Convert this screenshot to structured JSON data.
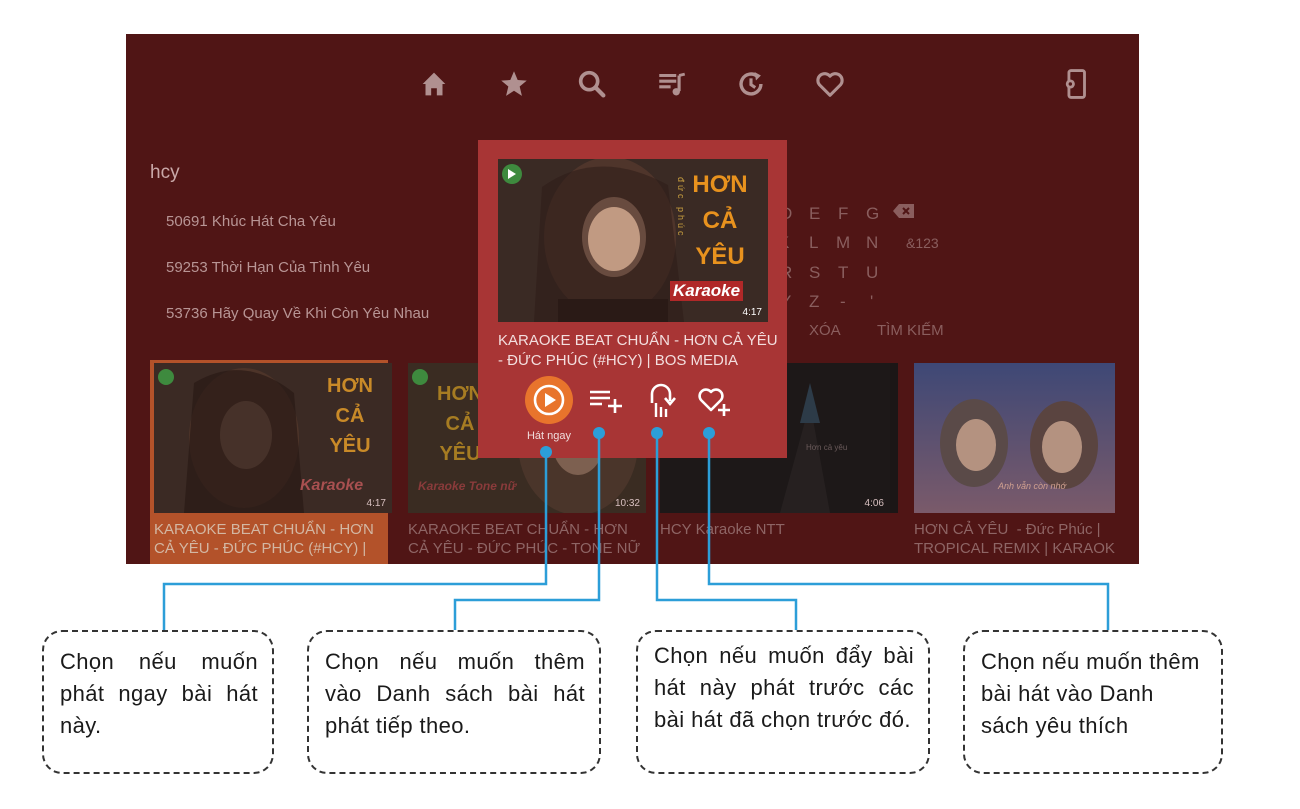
{
  "search": {
    "query": "hcy"
  },
  "suggestions": [
    "50691 Khúc Hát Cha Yêu",
    "59253 Thời Hạn Của Tình Yêu",
    "53736 Hãy Quay Về Khi Còn Yêu Nhau"
  ],
  "keyboard": {
    "row1": [
      "D",
      "E",
      "F",
      "G"
    ],
    "row2": [
      "K",
      "L",
      "M",
      "N",
      "&123"
    ],
    "row3": [
      "R",
      "S",
      "T",
      "U"
    ],
    "row4": [
      "Y",
      "Z",
      "-",
      "'"
    ],
    "delete_key": "XÓA",
    "search_key": "TÌM KIẾM"
  },
  "nav_icons": [
    "home-icon",
    "star-icon",
    "search-icon",
    "playlist-icon",
    "history-icon",
    "heart-icon",
    "settings-icon"
  ],
  "popup": {
    "thumb_title": [
      "HƠN",
      "CẢ",
      "YÊU"
    ],
    "thumb_artist": "đức phúc",
    "thumb_badge": "Karaoke",
    "duration": "4:17",
    "title": "KARAOKE BEAT CHUẨN - HƠN CẢ YÊU - ĐỨC PHÚC (#HCY) | BOS MEDIA",
    "play_label": "Hát ngay"
  },
  "results": [
    {
      "title": "KARAOKE BEAT CHUẨN - HƠN\nCẢ YÊU - ĐỨC PHÚC (#HCY) |",
      "duration": "4:17",
      "thumb_title": [
        "HƠN",
        "CẢ",
        "YÊU"
      ],
      "badge": "Karaoke"
    },
    {
      "title": "KARAOKE BEAT CHUẨN - HƠN\nCẢ YÊU - ĐỨC PHÚC - TONE NỮ",
      "duration": "10:32",
      "thumb_title": [
        "HƠN",
        "CẢ",
        "YÊU"
      ],
      "badge": "Karaoke Tone nữ"
    },
    {
      "title": "HCY Karaoke NTT",
      "duration": "4:06",
      "caption": "Hơn cả yêu"
    },
    {
      "title": "HƠN CẢ YÊU  - Đức Phúc |\nTROPICAL REMIX | KARAOKE",
      "caption": "Anh vẫn còn nhớ"
    }
  ],
  "notes": [
    "Chọn nếu muốn phát ngay bài hát này.",
    "Chọn nếu muốn thêm vào Danh sách bài hát phát tiếp theo.",
    "Chọn nếu muốn đẩy bài hát này phát trước các bài hát đã chọn trước đó.",
    "Chọn nếu muốn thêm bài hát vào Danh sách yêu thích"
  ],
  "colors": {
    "screen": "#501515",
    "popup": "#a83535",
    "accent": "#e8742c",
    "callout_line": "#2c9ed8"
  }
}
